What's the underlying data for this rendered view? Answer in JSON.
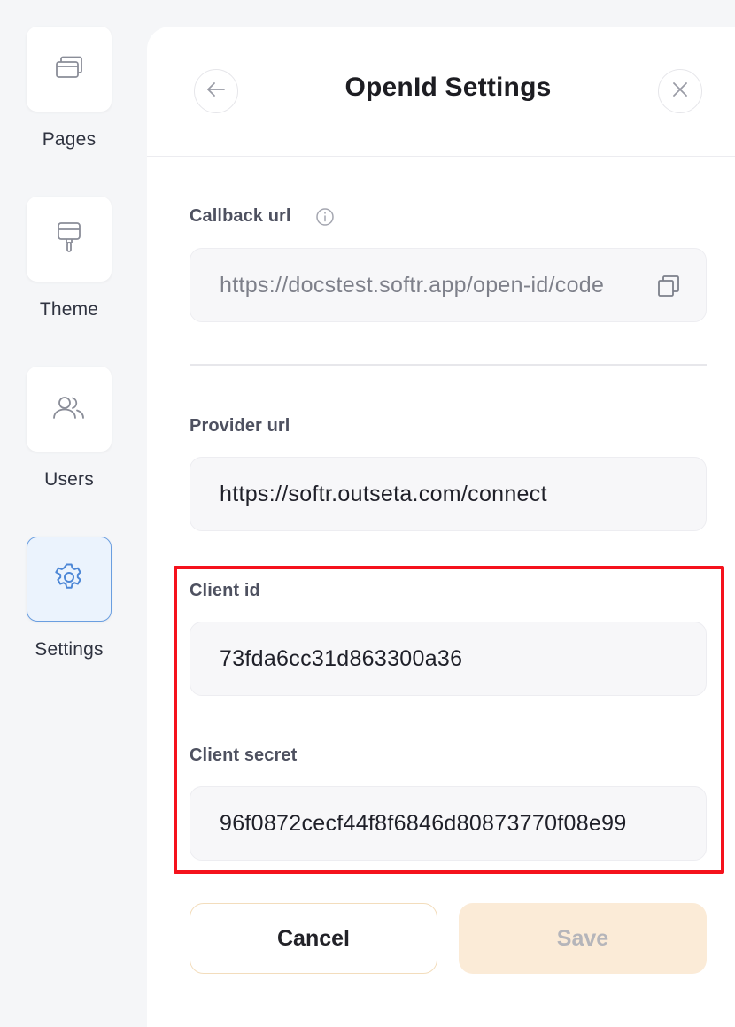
{
  "sidebar": {
    "items": [
      {
        "label": "Pages",
        "icon": "pages-icon",
        "active": false
      },
      {
        "label": "Theme",
        "icon": "paint-roller-icon",
        "active": false
      },
      {
        "label": "Users",
        "icon": "users-icon",
        "active": false
      },
      {
        "label": "Settings",
        "icon": "gear-icon",
        "active": true
      }
    ]
  },
  "panel": {
    "title": "OpenId Settings",
    "back_icon": "arrow-left-icon",
    "close_icon": "close-icon"
  },
  "fields": {
    "callback_url": {
      "label": "Callback url",
      "value": "https://docstest.softr.app/open-id/code",
      "info_icon": "info-icon",
      "copy_icon": "copy-icon"
    },
    "provider_url": {
      "label": "Provider url",
      "value": "https://softr.outseta.com/connect"
    },
    "client_id": {
      "label": "Client id",
      "value": "73fda6cc31d863300a36"
    },
    "client_secret": {
      "label": "Client secret",
      "value": "96f0872cecf44f8f6846d80873770f08e99"
    }
  },
  "actions": {
    "cancel_label": "Cancel",
    "save_label": "Save"
  },
  "colors": {
    "highlight": "#f5121c",
    "active_tile_bg": "#ebf3fd",
    "active_tile_border": "#6a9ee0",
    "save_bg": "#fbebd7",
    "cancel_border": "#f3ddbc"
  }
}
